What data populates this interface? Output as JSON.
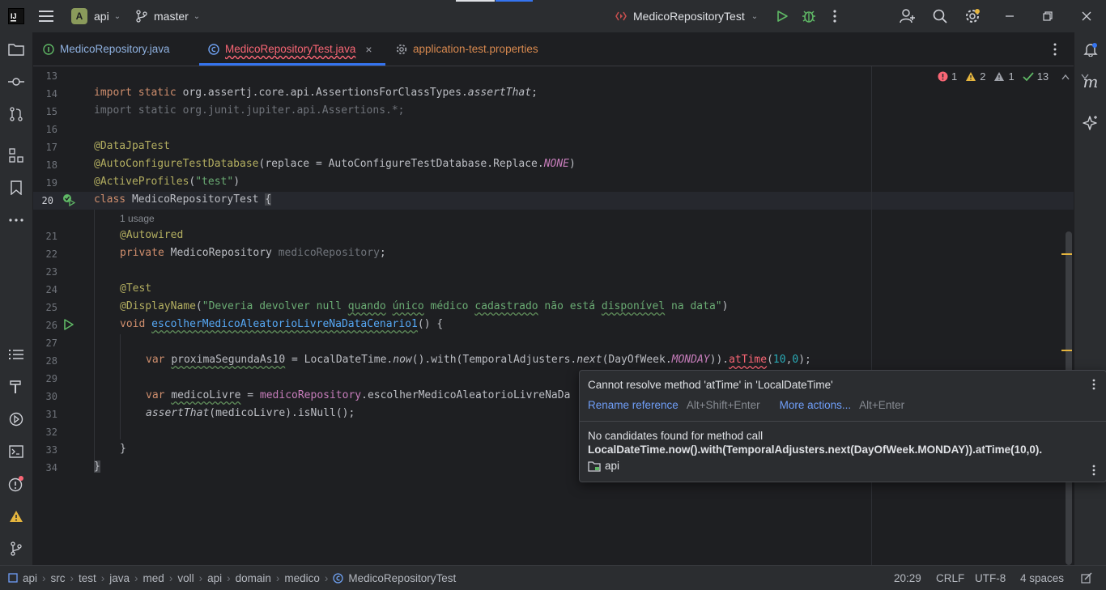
{
  "titlebar": {
    "project_badge": "A",
    "project": "api",
    "branch": "master",
    "run_config": "MedicoRepositoryTest"
  },
  "tabs": [
    {
      "label": "MedicoRepository.java",
      "active": false
    },
    {
      "label": "MedicoRepositoryTest.java",
      "active": true
    },
    {
      "label": "application-test.properties",
      "active": false
    }
  ],
  "inspections": {
    "errors": "1",
    "warnings": "2",
    "weak_warnings": "1",
    "typos": "13"
  },
  "editor": {
    "line_numbers": [
      "13",
      "14",
      "15",
      "16",
      "17",
      "18",
      "19",
      "20",
      "21",
      "22",
      "23",
      "24",
      "25",
      "26",
      "27",
      "28",
      "29",
      "30",
      "31",
      "32",
      "33",
      "34"
    ],
    "usage_hint": "1 usage",
    "lines": {
      "l14_kw": "import static ",
      "l14_pkg": "org.assertj.core.api.AssertionsForClassTypes.",
      "l14_m": "assertThat",
      "l15": "import static org.junit.jupiter.api.Assertions.*;",
      "l17": "@DataJpaTest",
      "l18_ann": "@AutoConfigureTestDatabase",
      "l18_a": "(replace = AutoConfigureTestDatabase.Replace.",
      "l18_b": "NONE",
      "l18_c": ")",
      "l19_ann": "@ActiveProfiles",
      "l19_s": "\"test\"",
      "l20_kw": "class ",
      "l20_name": "MedicoRepositoryTest ",
      "l20_brace": "{",
      "l21": "@Autowired",
      "l22_kw": "private ",
      "l22_type": "MedicoRepository ",
      "l22_field": "medicoRepository",
      "l24": "@Test",
      "l25_ann": "@DisplayName",
      "l25_s1": "\"Deveria devolver null ",
      "l25_w1": "quando",
      "l25_w2": "único",
      "l25_s2": " médico ",
      "l25_w3": "cadastrado",
      "l25_s3": " não está ",
      "l25_w4": "disponível",
      "l25_s4": " na data\"",
      "l26_kw": "void ",
      "l26_name": "escolherMedicoAleatorioLivreNaDataCenario1",
      "l26_rest": "() {",
      "l28_kw": "var ",
      "l28_var": "proximaSegundaAs10",
      "l28_a": " = LocalDateTime.",
      "l28_now": "now",
      "l28_b": "().with(TemporalAdjusters.",
      "l28_next": "next",
      "l28_c": "(DayOfWeek.",
      "l28_monday": "MONDAY",
      "l28_d": ")).",
      "l28_attime": "atTime",
      "l28_e": "(",
      "l28_n1": "10",
      "l28_f": ",",
      "l28_n2": "0",
      "l28_g": ");",
      "l30_kw": "var ",
      "l30_var": "medicoLivre",
      "l30_a": " = ",
      "l30_field": "medicoRepository",
      "l30_b": ".escolherMedicoAleatorioLivreNaDa",
      "l31_m": "assertThat",
      "l31_rest": "(medicoLivre).isNull();",
      "l33": "}",
      "l34": "}"
    }
  },
  "popup": {
    "title": "Cannot resolve method 'atTime' in 'LocalDateTime'",
    "rename_action": "Rename reference",
    "rename_shortcut": "Alt+Shift+Enter",
    "more_action": "More actions...",
    "more_shortcut": "Alt+Enter",
    "detail_line1": "No candidates found for method call",
    "detail_line2": "LocalDateTime.now().with(TemporalAdjusters.next(DayOfWeek.MONDAY)).atTime(10,0).",
    "module": "api"
  },
  "statusbar": {
    "breadcrumbs": [
      "api",
      "src",
      "test",
      "java",
      "med",
      "voll",
      "api",
      "domain",
      "medico",
      "MedicoRepositoryTest"
    ],
    "position": "20:29",
    "line_sep": "CRLF",
    "encoding": "UTF-8",
    "indent": "4 spaces"
  },
  "colors": {
    "accent": "#3574f0",
    "error": "#fa6675",
    "warning": "#e5b53e",
    "run": "#5fb865"
  }
}
